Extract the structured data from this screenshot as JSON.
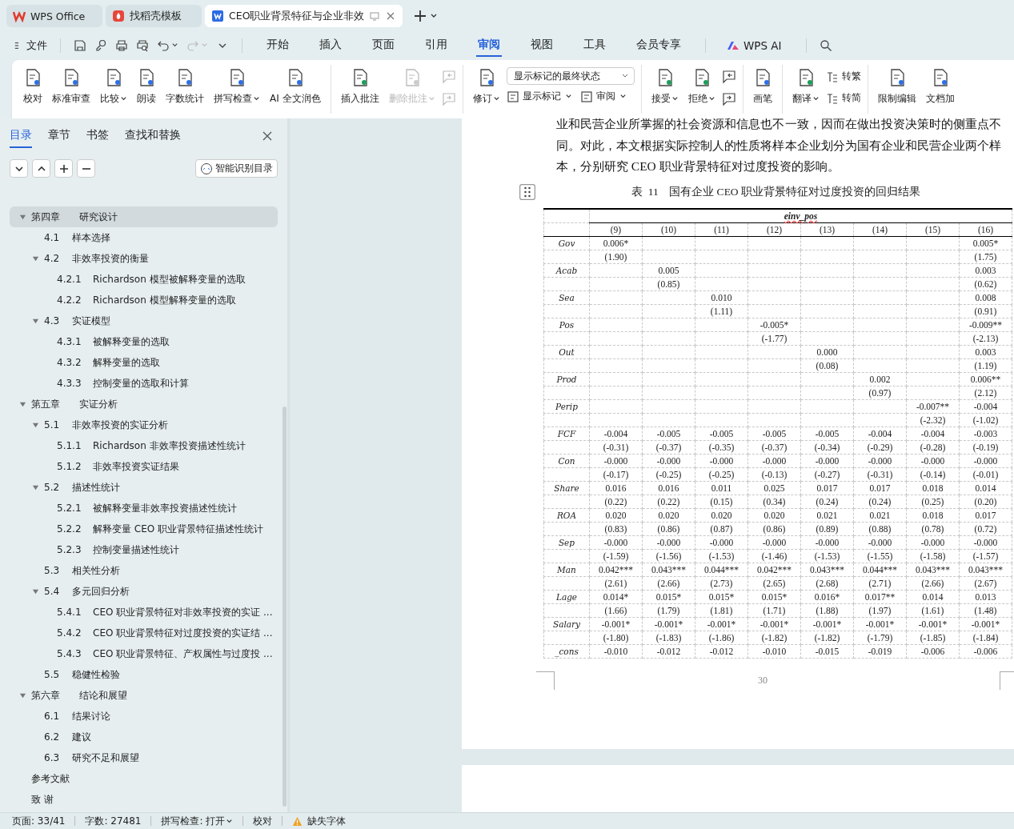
{
  "browser_tabs": [
    {
      "title": "WPS Office",
      "selected": false
    },
    {
      "title": "找稻壳模板",
      "selected": false
    },
    {
      "title": "CEO职业背景特征与企业非效",
      "selected": true
    }
  ],
  "menu": {
    "file": "文件",
    "tabs": [
      {
        "label": "开始",
        "selected": false
      },
      {
        "label": "插入",
        "selected": false
      },
      {
        "label": "页面",
        "selected": false
      },
      {
        "label": "引用",
        "selected": false
      },
      {
        "label": "审阅",
        "selected": true
      },
      {
        "label": "视图",
        "selected": false
      },
      {
        "label": "工具",
        "selected": false
      },
      {
        "label": "会员专享",
        "selected": false
      }
    ],
    "ai": "WPS AI"
  },
  "ribbon": [
    {
      "items": [
        {
          "kind": "big",
          "label": "校对",
          "dropdown": false,
          "disabled": false
        },
        {
          "kind": "big",
          "label": "标准审查",
          "dropdown": false,
          "disabled": false
        },
        {
          "kind": "big",
          "label": "比较",
          "dropdown": true,
          "disabled": false
        },
        {
          "kind": "big",
          "label": "朗读",
          "dropdown": false,
          "disabled": false
        },
        {
          "kind": "big",
          "label": "字数统计",
          "dropdown": false,
          "disabled": false
        },
        {
          "kind": "big",
          "label": "拼写检查",
          "dropdown": true,
          "disabled": false
        },
        {
          "kind": "big",
          "label": "AI 全文润色",
          "dropdown": false,
          "disabled": false
        }
      ]
    },
    {
      "items": [
        {
          "kind": "big",
          "label": "插入批注",
          "dropdown": false,
          "disabled": false
        },
        {
          "kind": "big",
          "label": "删除批注",
          "dropdown": true,
          "disabled": true
        },
        {
          "kind": "nav",
          "disabled": true
        }
      ]
    },
    {
      "items": [
        {
          "kind": "big",
          "label": "修订",
          "dropdown": true,
          "disabled": false
        },
        {
          "kind": "select",
          "value": "显示标记的最终状态",
          "buttons": [
            {
              "label": "显示标记",
              "dropdown": true
            },
            {
              "label": "审阅",
              "dropdown": true
            }
          ]
        }
      ]
    },
    {
      "items": [
        {
          "kind": "big",
          "label": "接受",
          "dropdown": true,
          "disabled": false
        },
        {
          "kind": "big",
          "label": "拒绝",
          "dropdown": true,
          "disabled": false
        },
        {
          "kind": "nav",
          "disabled": false
        }
      ]
    },
    {
      "items": [
        {
          "kind": "big",
          "label": "画笔",
          "dropdown": false,
          "disabled": false
        }
      ]
    },
    {
      "items": [
        {
          "kind": "big",
          "label": "翻译",
          "dropdown": true,
          "disabled": false
        },
        {
          "kind": "pair",
          "buttons": [
            {
              "label": "转繁",
              "dropdown": false
            },
            {
              "label": "转简",
              "dropdown": false
            }
          ]
        }
      ]
    },
    {
      "items": [
        {
          "kind": "big",
          "label": "限制编辑",
          "dropdown": false,
          "disabled": false
        },
        {
          "kind": "big",
          "label": "文档加",
          "dropdown": false,
          "disabled": false
        }
      ]
    }
  ],
  "sidebar": {
    "tabs": [
      {
        "label": "目录",
        "selected": true
      },
      {
        "label": "章节",
        "selected": false
      },
      {
        "label": "书签",
        "selected": false
      },
      {
        "label": "查找和替换",
        "selected": false
      }
    ],
    "smart_button": "智能识别目录",
    "toc": [
      {
        "num": "第四章",
        "title": "研究设计",
        "selected": true,
        "expanded": true,
        "children": [
          {
            "num": "4.1",
            "title": "样本选择",
            "selected": false
          },
          {
            "num": "4.2",
            "title": "非效率投资的衡量",
            "selected": false,
            "expanded": true,
            "children": [
              {
                "num": "4.2.1",
                "title": "Richardson 模型被解释变量的选取",
                "selected": false
              },
              {
                "num": "4.2.2",
                "title": "Richardson 模型解释变量的选取",
                "selected": false
              }
            ]
          },
          {
            "num": "4.3",
            "title": "实证模型",
            "selected": false,
            "expanded": true,
            "children": [
              {
                "num": "4.3.1",
                "title": "被解释变量的选取",
                "selected": false
              },
              {
                "num": "4.3.2",
                "title": "解释变量的选取",
                "selected": false
              },
              {
                "num": "4.3.3",
                "title": "控制变量的选取和计算",
                "selected": false
              }
            ]
          }
        ]
      },
      {
        "num": "第五章",
        "title": "实证分析",
        "selected": false,
        "expanded": true,
        "children": [
          {
            "num": "5.1",
            "title": "非效率投资的实证分析",
            "selected": false,
            "expanded": true,
            "children": [
              {
                "num": "5.1.1",
                "title": "Richardson 非效率投资描述性统计",
                "selected": false
              },
              {
                "num": "5.1.2",
                "title": "非效率投资实证结果",
                "selected": false
              }
            ]
          },
          {
            "num": "5.2",
            "title": "描述性统计",
            "selected": false,
            "expanded": true,
            "children": [
              {
                "num": "5.2.1",
                "title": "被解释变量非效率投资描述性统计",
                "selected": false
              },
              {
                "num": "5.2.2",
                "title": "解释变量 CEO 职业背景特征描述性统计",
                "selected": false
              },
              {
                "num": "5.2.3",
                "title": "控制变量描述性统计",
                "selected": false
              }
            ]
          },
          {
            "num": "5.3",
            "title": "相关性分析",
            "selected": false
          },
          {
            "num": "5.4",
            "title": "多元回归分析",
            "selected": false,
            "expanded": true,
            "children": [
              {
                "num": "5.4.1",
                "title": "CEO 职业背景特征对非效率投资的实证 ...",
                "selected": false
              },
              {
                "num": "5.4.2",
                "title": "CEO 职业背景特征对过度投资的实证结 ...",
                "selected": false
              },
              {
                "num": "5.4.3",
                "title": "CEO 职业背景特征、产权属性与过度投 ...",
                "selected": false
              }
            ]
          },
          {
            "num": "5.5",
            "title": "稳健性检验",
            "selected": false
          }
        ]
      },
      {
        "num": "第六章",
        "title": "结论和展望",
        "selected": false,
        "expanded": true,
        "children": [
          {
            "num": "6.1",
            "title": "结果讨论",
            "selected": false
          },
          {
            "num": "6.2",
            "title": "建议",
            "selected": false
          },
          {
            "num": "6.3",
            "title": "研究不足和展望",
            "selected": false
          }
        ]
      },
      {
        "title": "参考文献",
        "selected": false
      },
      {
        "title": "致 谢",
        "selected": false
      }
    ]
  },
  "document": {
    "paragraph": "业和民营企业所掌握的社会资源和信息也不一致，因而在做出投资决策时的侧重点不同。对此，本文根据实际控制人的性质将样本企业划分为国有企业和民营企业两个样本，分别研究 CEO 职业背景特征对过度投资的影响。",
    "caption": "表  11    国有企业 CEO 职业背景特征对过度投资的回归结果",
    "table": {
      "dependent": "einv_pos",
      "columns": [
        "(9)",
        "(10)",
        "(11)",
        "(12)",
        "(13)",
        "(14)",
        "(15)",
        "(16)"
      ],
      "rows": [
        {
          "var": "Gov",
          "cells": [
            {
              "kind": "value",
              "coef": "0.006*",
              "t": "(1.90)"
            },
            {
              "kind": "empty"
            },
            {
              "kind": "empty"
            },
            {
              "kind": "empty"
            },
            {
              "kind": "empty"
            },
            {
              "kind": "empty"
            },
            {
              "kind": "empty"
            },
            {
              "kind": "value",
              "coef": "0.005*",
              "t": "(1.75)"
            }
          ]
        },
        {
          "var": "Acab",
          "cells": [
            {
              "kind": "empty"
            },
            {
              "kind": "value",
              "coef": "0.005",
              "t": "(0.85)"
            },
            {
              "kind": "empty"
            },
            {
              "kind": "empty"
            },
            {
              "kind": "empty"
            },
            {
              "kind": "empty"
            },
            {
              "kind": "empty"
            },
            {
              "kind": "value",
              "coef": "0.003",
              "t": "(0.62)"
            }
          ]
        },
        {
          "var": "Sea",
          "cells": [
            {
              "kind": "empty"
            },
            {
              "kind": "empty"
            },
            {
              "kind": "value",
              "coef": "0.010",
              "t": "(1.11)"
            },
            {
              "kind": "empty"
            },
            {
              "kind": "empty"
            },
            {
              "kind": "empty"
            },
            {
              "kind": "empty"
            },
            {
              "kind": "value",
              "coef": "0.008",
              "t": "(0.91)"
            }
          ]
        },
        {
          "var": "Pos",
          "cells": [
            {
              "kind": "empty"
            },
            {
              "kind": "empty"
            },
            {
              "kind": "empty"
            },
            {
              "kind": "value",
              "coef": "-0.005*",
              "t": "(-1.77)"
            },
            {
              "kind": "empty"
            },
            {
              "kind": "empty"
            },
            {
              "kind": "empty"
            },
            {
              "kind": "value",
              "coef": "-0.009**",
              "t": "(-2.13)"
            }
          ]
        },
        {
          "var": "Out",
          "cells": [
            {
              "kind": "empty"
            },
            {
              "kind": "empty"
            },
            {
              "kind": "empty"
            },
            {
              "kind": "empty"
            },
            {
              "kind": "value",
              "coef": "0.000",
              "t": "(0.08)"
            },
            {
              "kind": "empty"
            },
            {
              "kind": "empty"
            },
            {
              "kind": "value",
              "coef": "0.003",
              "t": "(1.19)"
            }
          ]
        },
        {
          "var": "Prod",
          "cells": [
            {
              "kind": "empty"
            },
            {
              "kind": "empty"
            },
            {
              "kind": "empty"
            },
            {
              "kind": "empty"
            },
            {
              "kind": "empty"
            },
            {
              "kind": "value",
              "coef": "0.002",
              "t": "(0.97)"
            },
            {
              "kind": "empty"
            },
            {
              "kind": "value",
              "coef": "0.006**",
              "t": "(2.12)"
            }
          ]
        },
        {
          "var": "Perip",
          "cells": [
            {
              "kind": "empty"
            },
            {
              "kind": "empty"
            },
            {
              "kind": "empty"
            },
            {
              "kind": "empty"
            },
            {
              "kind": "empty"
            },
            {
              "kind": "empty"
            },
            {
              "kind": "value",
              "coef": "-0.007**",
              "t": "(-2.32)"
            },
            {
              "kind": "value",
              "coef": "-0.004",
              "t": "(-1.02)"
            }
          ]
        },
        {
          "var": "FCF",
          "cells": [
            {
              "kind": "value",
              "coef": "-0.004",
              "t": "(-0.31)"
            },
            {
              "kind": "value",
              "coef": "-0.005",
              "t": "(-0.37)"
            },
            {
              "kind": "value",
              "coef": "-0.005",
              "t": "(-0.35)"
            },
            {
              "kind": "value",
              "coef": "-0.005",
              "t": "(-0.37)"
            },
            {
              "kind": "value",
              "coef": "-0.005",
              "t": "(-0.34)"
            },
            {
              "kind": "value",
              "coef": "-0.004",
              "t": "(-0.29)"
            },
            {
              "kind": "value",
              "coef": "-0.004",
              "t": "(-0.28)"
            },
            {
              "kind": "value",
              "coef": "-0.003",
              "t": "(-0.19)"
            }
          ]
        },
        {
          "var": "Con",
          "cells": [
            {
              "kind": "value",
              "coef": "-0.000",
              "t": "(-0.17)"
            },
            {
              "kind": "value",
              "coef": "-0.000",
              "t": "(-0.25)"
            },
            {
              "kind": "value",
              "coef": "-0.000",
              "t": "(-0.25)"
            },
            {
              "kind": "value",
              "coef": "-0.000",
              "t": "(-0.13)"
            },
            {
              "kind": "value",
              "coef": "-0.000",
              "t": "(-0.27)"
            },
            {
              "kind": "value",
              "coef": "-0.000",
              "t": "(-0.31)"
            },
            {
              "kind": "value",
              "coef": "-0.000",
              "t": "(-0.14)"
            },
            {
              "kind": "value",
              "coef": "-0.000",
              "t": "(-0.01)"
            }
          ]
        },
        {
          "var": "Share",
          "cells": [
            {
              "kind": "value",
              "coef": "0.016",
              "t": "(0.22)"
            },
            {
              "kind": "value",
              "coef": "0.016",
              "t": "(0.22)"
            },
            {
              "kind": "value",
              "coef": "0.011",
              "t": "(0.15)"
            },
            {
              "kind": "value",
              "coef": "0.025",
              "t": "(0.34)"
            },
            {
              "kind": "value",
              "coef": "0.017",
              "t": "(0.24)"
            },
            {
              "kind": "value",
              "coef": "0.017",
              "t": "(0.24)"
            },
            {
              "kind": "value",
              "coef": "0.018",
              "t": "(0.25)"
            },
            {
              "kind": "value",
              "coef": "0.014",
              "t": "(0.20)"
            }
          ]
        },
        {
          "var": "ROA",
          "cells": [
            {
              "kind": "value",
              "coef": "0.020",
              "t": "(0.83)"
            },
            {
              "kind": "value",
              "coef": "0.020",
              "t": "(0.86)"
            },
            {
              "kind": "value",
              "coef": "0.020",
              "t": "(0.87)"
            },
            {
              "kind": "value",
              "coef": "0.020",
              "t": "(0.86)"
            },
            {
              "kind": "value",
              "coef": "0.021",
              "t": "(0.89)"
            },
            {
              "kind": "value",
              "coef": "0.021",
              "t": "(0.88)"
            },
            {
              "kind": "value",
              "coef": "0.018",
              "t": "(0.78)"
            },
            {
              "kind": "value",
              "coef": "0.017",
              "t": "(0.72)"
            }
          ]
        },
        {
          "var": "Sep",
          "cells": [
            {
              "kind": "value",
              "coef": "-0.000",
              "t": "(-1.59)"
            },
            {
              "kind": "value",
              "coef": "-0.000",
              "t": "(-1.56)"
            },
            {
              "kind": "value",
              "coef": "-0.000",
              "t": "(-1.53)"
            },
            {
              "kind": "value",
              "coef": "-0.000",
              "t": "(-1.46)"
            },
            {
              "kind": "value",
              "coef": "-0.000",
              "t": "(-1.53)"
            },
            {
              "kind": "value",
              "coef": "-0.000",
              "t": "(-1.55)"
            },
            {
              "kind": "value",
              "coef": "-0.000",
              "t": "(-1.58)"
            },
            {
              "kind": "value",
              "coef": "-0.000",
              "t": "(-1.57)"
            }
          ]
        },
        {
          "var": "Man",
          "cells": [
            {
              "kind": "value",
              "coef": "0.042***",
              "t": "(2.61)"
            },
            {
              "kind": "value",
              "coef": "0.043***",
              "t": "(2.66)"
            },
            {
              "kind": "value",
              "coef": "0.044***",
              "t": "(2.73)"
            },
            {
              "kind": "value",
              "coef": "0.042***",
              "t": "(2.65)"
            },
            {
              "kind": "value",
              "coef": "0.043***",
              "t": "(2.68)"
            },
            {
              "kind": "value",
              "coef": "0.044***",
              "t": "(2.71)"
            },
            {
              "kind": "value",
              "coef": "0.043***",
              "t": "(2.66)"
            },
            {
              "kind": "value",
              "coef": "0.043***",
              "t": "(2.67)"
            }
          ]
        },
        {
          "var": "Lage",
          "cells": [
            {
              "kind": "value",
              "coef": "0.014*",
              "t": "(1.66)"
            },
            {
              "kind": "value",
              "coef": "0.015*",
              "t": "(1.79)"
            },
            {
              "kind": "value",
              "coef": "0.015*",
              "t": "(1.81)"
            },
            {
              "kind": "value",
              "coef": "0.015*",
              "t": "(1.71)"
            },
            {
              "kind": "value",
              "coef": "0.016*",
              "t": "(1.88)"
            },
            {
              "kind": "value",
              "coef": "0.017**",
              "t": "(1.97)"
            },
            {
              "kind": "value",
              "coef": "0.014",
              "t": "(1.61)"
            },
            {
              "kind": "value",
              "coef": "0.013",
              "t": "(1.48)"
            }
          ]
        },
        {
          "var": "Salary",
          "cells": [
            {
              "kind": "value",
              "coef": "-0.001*",
              "t": "(-1.80)"
            },
            {
              "kind": "value",
              "coef": "-0.001*",
              "t": "(-1.83)"
            },
            {
              "kind": "value",
              "coef": "-0.001*",
              "t": "(-1.86)"
            },
            {
              "kind": "value",
              "coef": "-0.001*",
              "t": "(-1.82)"
            },
            {
              "kind": "value",
              "coef": "-0.001*",
              "t": "(-1.82)"
            },
            {
              "kind": "value",
              "coef": "-0.001*",
              "t": "(-1.79)"
            },
            {
              "kind": "value",
              "coef": "-0.001*",
              "t": "(-1.85)"
            },
            {
              "kind": "value",
              "coef": "-0.001*",
              "t": "(-1.84)"
            }
          ]
        },
        {
          "var": "_cons",
          "cells": [
            {
              "kind": "value",
              "coef": "-0.010"
            },
            {
              "kind": "value",
              "coef": "-0.012"
            },
            {
              "kind": "value",
              "coef": "-0.012"
            },
            {
              "kind": "value",
              "coef": "-0.010"
            },
            {
              "kind": "value",
              "coef": "-0.015"
            },
            {
              "kind": "value",
              "coef": "-0.019"
            },
            {
              "kind": "value",
              "coef": "-0.006"
            },
            {
              "kind": "value",
              "coef": "-0.006"
            }
          ]
        }
      ]
    },
    "page_number": "30"
  },
  "status_bar": {
    "page": "页面: 33/41",
    "words": "字数: 27481",
    "spell": "拼写检查: 打开",
    "proof": "校对",
    "missing_fonts": "缺失字体"
  }
}
